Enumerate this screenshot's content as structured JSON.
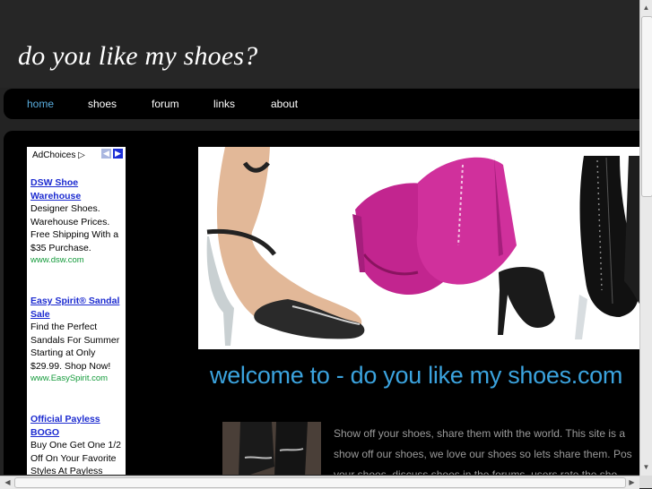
{
  "site": {
    "title": "do you like my shoes?"
  },
  "nav": {
    "items": [
      "home",
      "shoes",
      "forum",
      "links",
      "about"
    ],
    "active": "home"
  },
  "ad": {
    "choices_label": "AdChoices ▷",
    "prev": "◀",
    "next": "▶",
    "items": [
      {
        "title_line1": "DSW Shoe",
        "title_line2": "Warehouse",
        "lines": [
          "Designer Shoes.",
          "Warehouse Prices.",
          "Free Shipping With a",
          "$35 Purchase."
        ],
        "url": "www.dsw.com"
      },
      {
        "title_line1": "Easy Spirit® Sandal",
        "title_line2": "Sale",
        "lines": [
          "Find the Perfect",
          "Sandals For Summer",
          "Starting at Only",
          "$29.99. Shop Now!"
        ],
        "url": "www.EasySpirit.com"
      },
      {
        "title_line1": "Official Payless",
        "title_line2": "BOGO",
        "lines": [
          "Buy One Get One 1/2",
          "Off On Your Favorite",
          "Styles At Payless"
        ],
        "url": ""
      }
    ]
  },
  "main": {
    "welcome": "welcome to - do you like my shoes.com",
    "body_lines": [
      "Show off your shoes, share them with the world. This site is a",
      "show off our shoes, we love our shoes so lets share them. Pos",
      "your shoes, discuss shoes in the forums, users rate the sho"
    ]
  },
  "colors": {
    "accent": "#3ba3de",
    "nav_active": "#5aaee0",
    "ad_link": "#1c2bd0",
    "ad_url": "#139a3a"
  }
}
